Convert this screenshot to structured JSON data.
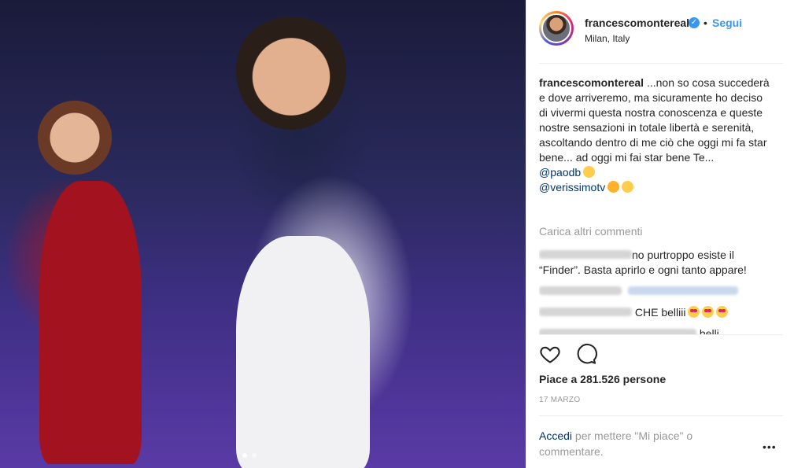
{
  "photo": {
    "alt": "",
    "carousel_pages": 2,
    "carousel_active": 1
  },
  "post": {
    "username": "francescomontereal",
    "bullet": "•",
    "follow_label": "Segui",
    "location": "Milan, Italy",
    "caption_author": "francescomontereal",
    "caption_text": "...non so cosa succederà e dove arriveremo, ma sicuramente ho deciso di vivermi questa nostra conoscenza e queste nostre sensazioni in totale libertà e serenità, ascoltando dentro di me ciò che oggi mi fa star bene... ad oggi mi fai star bene Te...",
    "mention_1": "@paodb",
    "mention_2": "@verissimotv",
    "load_more": "Carica altri commenti",
    "comment_1_text": "no purtroppo esiste il “Finder”. Basta aprirlo e ogni tanto appare!",
    "comment_3_text": "CHE belliii",
    "comment_4_text": "belli",
    "likes": "Piace a 281.526 persone",
    "date": "17 MARZO",
    "login_link": "Accedi",
    "login_text": " per mettere \"Mi piace\" o commentare.",
    "more_label": "•••"
  },
  "colors": {
    "accent": "#3897f0",
    "link": "#003569",
    "muted": "#999999"
  }
}
